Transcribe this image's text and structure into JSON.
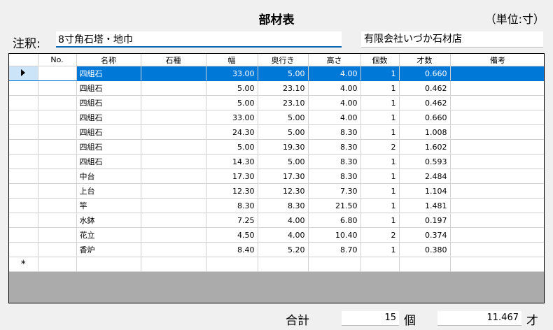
{
  "header": {
    "title": "部材表",
    "unit": "（単位:寸）"
  },
  "note": {
    "label": "注釈:",
    "value": "8寸角石塔・地巾"
  },
  "company": "有限会社いづか石材店",
  "table": {
    "columns": [
      "No.",
      "名称",
      "石種",
      "幅",
      "奥行き",
      "高さ",
      "個数",
      "才数",
      "備考"
    ],
    "rows": [
      {
        "no": "",
        "name": "四組石",
        "stone": "",
        "width": "33.00",
        "depth": "5.00",
        "height": "4.00",
        "count": "1",
        "sai": "0.660",
        "note": ""
      },
      {
        "no": "",
        "name": "四組石",
        "stone": "",
        "width": "5.00",
        "depth": "23.10",
        "height": "4.00",
        "count": "1",
        "sai": "0.462",
        "note": ""
      },
      {
        "no": "",
        "name": "四組石",
        "stone": "",
        "width": "5.00",
        "depth": "23.10",
        "height": "4.00",
        "count": "1",
        "sai": "0.462",
        "note": ""
      },
      {
        "no": "",
        "name": "四組石",
        "stone": "",
        "width": "33.00",
        "depth": "5.00",
        "height": "4.00",
        "count": "1",
        "sai": "0.660",
        "note": ""
      },
      {
        "no": "",
        "name": "四組石",
        "stone": "",
        "width": "24.30",
        "depth": "5.00",
        "height": "8.30",
        "count": "1",
        "sai": "1.008",
        "note": ""
      },
      {
        "no": "",
        "name": "四組石",
        "stone": "",
        "width": "5.00",
        "depth": "19.30",
        "height": "8.30",
        "count": "2",
        "sai": "1.602",
        "note": ""
      },
      {
        "no": "",
        "name": "四組石",
        "stone": "",
        "width": "14.30",
        "depth": "5.00",
        "height": "8.30",
        "count": "1",
        "sai": "0.593",
        "note": ""
      },
      {
        "no": "",
        "name": "中台",
        "stone": "",
        "width": "17.30",
        "depth": "17.30",
        "height": "8.30",
        "count": "1",
        "sai": "2.484",
        "note": ""
      },
      {
        "no": "",
        "name": "上台",
        "stone": "",
        "width": "12.30",
        "depth": "12.30",
        "height": "7.30",
        "count": "1",
        "sai": "1.104",
        "note": ""
      },
      {
        "no": "",
        "name": "竿",
        "stone": "",
        "width": "8.30",
        "depth": "8.30",
        "height": "21.50",
        "count": "1",
        "sai": "1.481",
        "note": ""
      },
      {
        "no": "",
        "name": "水鉢",
        "stone": "",
        "width": "7.25",
        "depth": "4.00",
        "height": "6.80",
        "count": "1",
        "sai": "0.197",
        "note": ""
      },
      {
        "no": "",
        "name": "花立",
        "stone": "",
        "width": "4.50",
        "depth": "4.00",
        "height": "10.40",
        "count": "2",
        "sai": "0.374",
        "note": ""
      },
      {
        "no": "",
        "name": "香炉",
        "stone": "",
        "width": "8.40",
        "depth": "5.20",
        "height": "8.70",
        "count": "1",
        "sai": "0.380",
        "note": ""
      }
    ],
    "new_row_marker": "*",
    "selected_row": 0
  },
  "totals": {
    "label": "合計",
    "count": "15",
    "count_unit": "個",
    "sai": "11.467",
    "sai_unit": "才"
  }
}
